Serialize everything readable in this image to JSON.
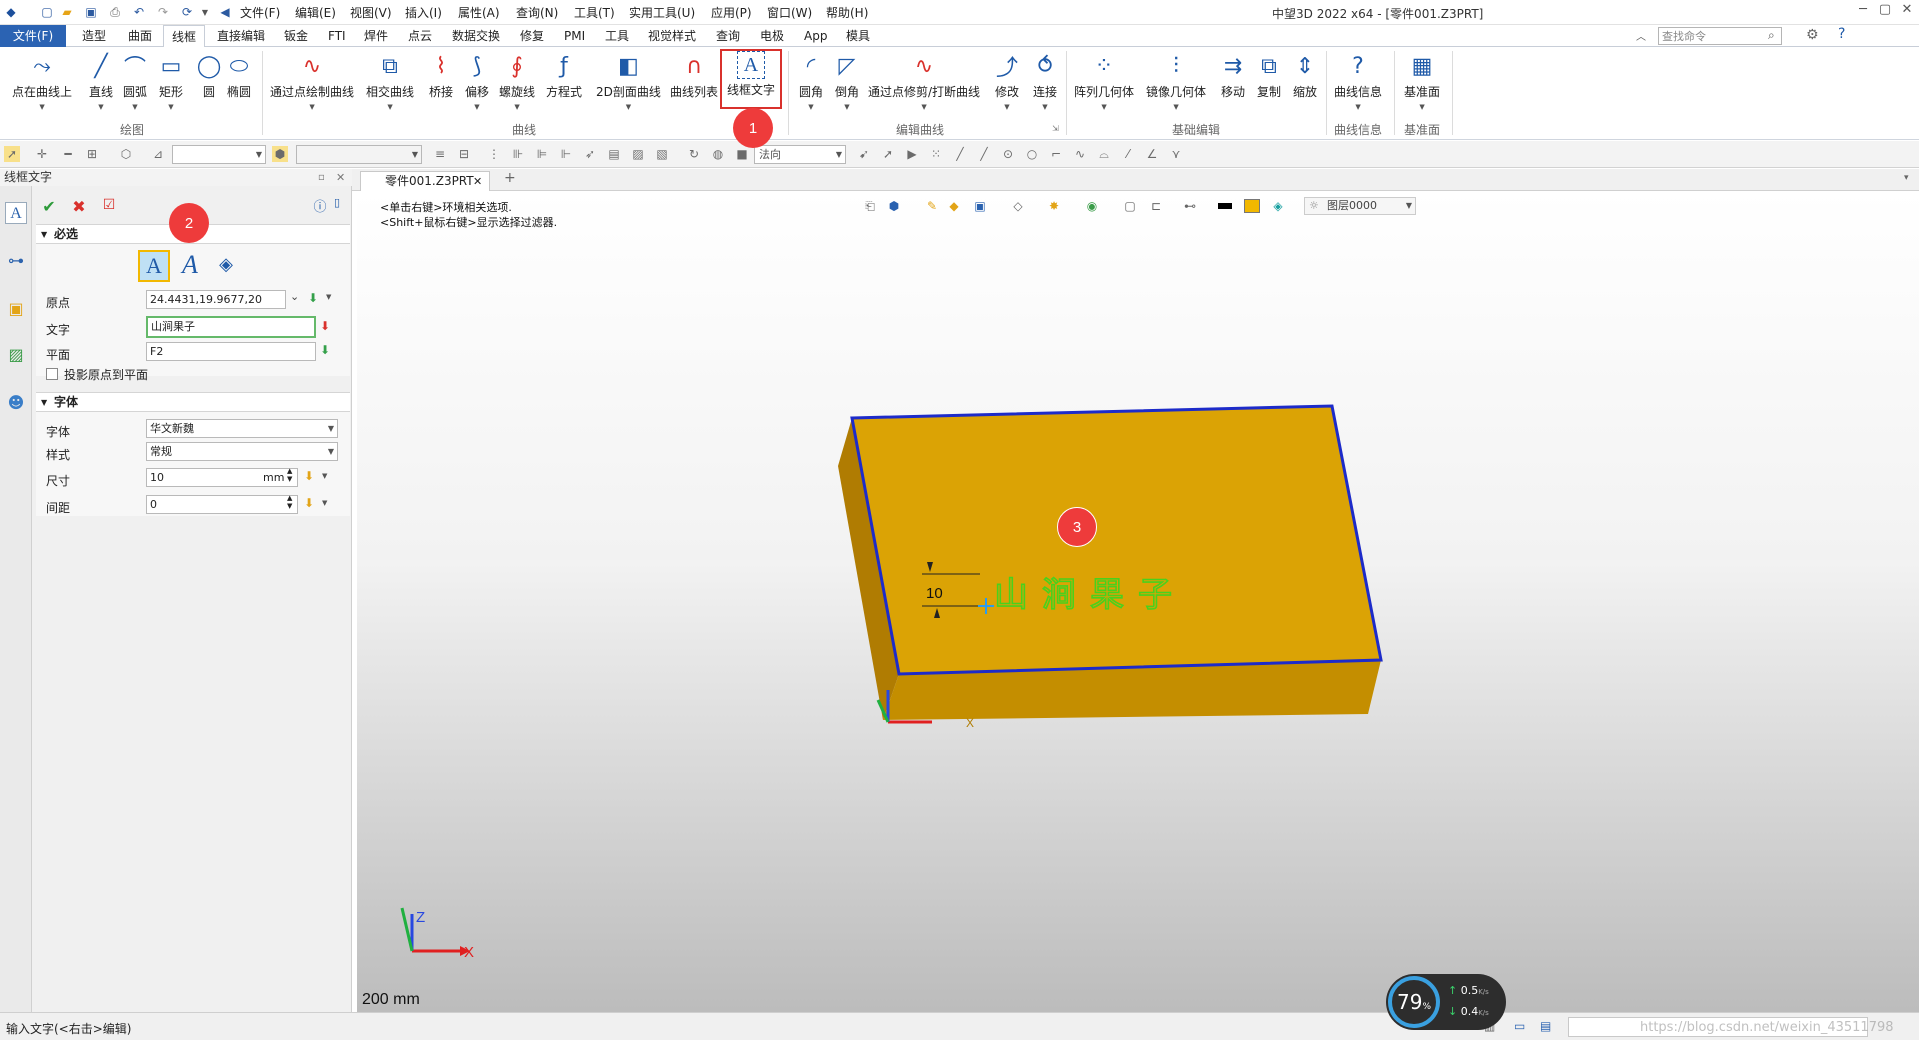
{
  "menu": [
    "文件(F)",
    "编辑(E)",
    "视图(V)",
    "插入(I)",
    "属性(A)",
    "查询(N)",
    "工具(T)",
    "实用工具(U)",
    "应用(P)",
    "窗口(W)",
    "帮助(H)"
  ],
  "window_title": "中望3D 2022 x64 - [零件001.Z3PRT]",
  "tabs": [
    "文件(F)",
    "造型",
    "曲面",
    "线框",
    "直接编辑",
    "钣金",
    "FTI",
    "焊件",
    "点云",
    "数据交换",
    "修复",
    "PMI",
    "工具",
    "视觉样式",
    "查询",
    "电极",
    "App",
    "模具"
  ],
  "search_placeholder": "查找命令",
  "ribbon": {
    "draw": [
      "点在曲线上",
      "直线",
      "圆弧",
      "矩形",
      "圆",
      "椭圆"
    ],
    "curve": [
      "通过点绘制曲线",
      "相交曲线",
      "桥接",
      "偏移",
      "螺旋线",
      "方程式",
      "2D剖面曲线",
      "曲线列表",
      "线框文字"
    ],
    "edit": [
      "圆角",
      "倒角",
      "通过点修剪/打断曲线",
      "修改",
      "连接"
    ],
    "basic": [
      "阵列几何体",
      "镜像几何体",
      "移动",
      "复制",
      "缩放"
    ],
    "info": [
      "曲线信息"
    ],
    "datum": [
      "基准面"
    ],
    "groups": [
      "绘图",
      "曲线",
      "编辑曲线",
      "基础编辑",
      "曲线信息",
      "基准面"
    ]
  },
  "toolbar2": {
    "normal_combo": "法向"
  },
  "panel": {
    "title": "线框文字",
    "required": "必选",
    "origin_label": "原点",
    "origin_value": "24.4431,19.9677,20",
    "text_label": "文字",
    "text_value": "山涧果子",
    "plane_label": "平面",
    "plane_value": "F2",
    "project_label": "投影原点到平面",
    "font_section": "字体",
    "font_label": "字体",
    "font_value": "华文新魏",
    "style_label": "样式",
    "style_value": "常规",
    "size_label": "尺寸",
    "size_value": "10",
    "size_unit": "mm",
    "spacing_label": "间距",
    "spacing_value": "0"
  },
  "doc_tab": "零件001.Z3PRT",
  "hints": [
    "<单击右键>环境相关选项.",
    "<Shift+鼠标右键>显示选择过滤器."
  ],
  "layer": "图层0000",
  "scene": {
    "dim_value": "10",
    "text_preview": "山涧果子",
    "axis_x": "X",
    "axis_z": "Z",
    "scale": "200 mm"
  },
  "badges": [
    "1",
    "2",
    "3"
  ],
  "status": "输入文字(<右击>编辑)",
  "speed": {
    "percent": "79",
    "pct_sign": "%",
    "up": "0.5",
    "down": "0.4",
    "unit": "K/s"
  },
  "watermark": "https://blog.csdn.net/weixin_43511798",
  "colors": {
    "accent": "#2b63b3",
    "block_face": "#dba305",
    "block_side": "#c48e00",
    "edge": "#1d2bc9",
    "preview_text": "#49d11d",
    "badge": "#ee3b3b"
  }
}
